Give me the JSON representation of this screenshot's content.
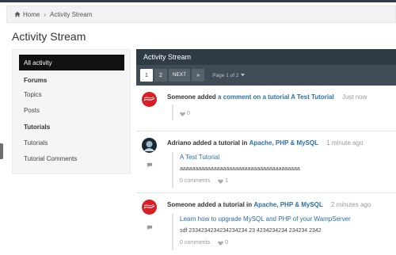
{
  "breadcrumb": {
    "home": "Home",
    "separator": "›",
    "current": "Activity Stream"
  },
  "page_title": "Activity Stream",
  "sidebar": {
    "all_activity": "All activity",
    "forums_heading": "Forums",
    "forums_items": [
      "Topics",
      "Posts"
    ],
    "tutorials_heading": "Tutorials",
    "tutorials_items": [
      "Tutorials",
      "Tutorial Comments"
    ]
  },
  "stream": {
    "header": "Activity Stream",
    "pager": {
      "page1": "1",
      "page2": "2",
      "next": "NEXT",
      "last": "»",
      "status": "Page 1 of 2"
    },
    "entries": [
      {
        "avatar": "coca-cola-logo",
        "actor": "Someone added",
        "link_text": "a comment on a tutorial A Test Tutorial",
        "time": "Just now",
        "likes": "0"
      },
      {
        "avatar": "user-avatar",
        "actor": "Adriano added a tutorial in",
        "category": "Apache, PHP & MySQL",
        "time": "1 minute ago",
        "title": "A Test Tutorial",
        "body": "aaaaaaaaaaaaaaaaaaaaaaaaaaaaaaaaaaaaaaa",
        "comments": "0 comments",
        "likes": "1"
      },
      {
        "avatar": "coca-cola-logo",
        "actor": "Someone added a tutorial in",
        "category": "Apache, PHP & MySQL",
        "time": "2 minutes ago",
        "title": "Learn how to upgrade MySQL and PHP of your WampServer",
        "body": "sdf 2334234234234234234 23 4234234234 234234 2342",
        "comments": "0 comments",
        "likes": "0"
      }
    ]
  },
  "colors": {
    "header_bg": "#2f3b45",
    "pager_bg": "#3f4b55",
    "link": "#2a6fa8",
    "active_nav": "#111111",
    "coke_red": "#d91f26"
  }
}
